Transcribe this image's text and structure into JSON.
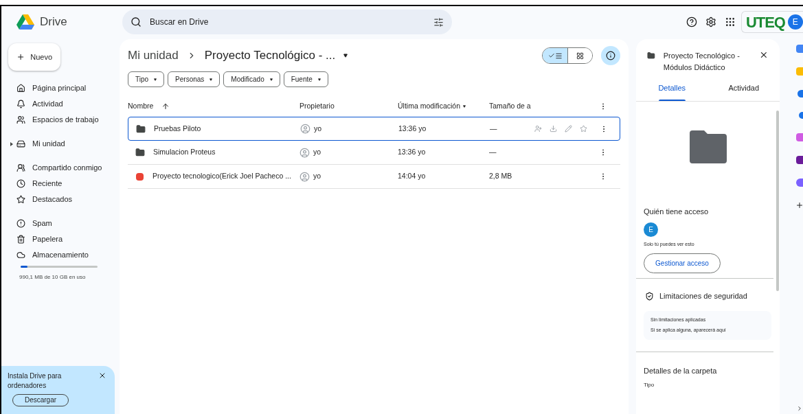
{
  "app": {
    "name": "Drive"
  },
  "search": {
    "placeholder": "Buscar en Drive"
  },
  "account": {
    "org": "UTEQ",
    "avatar": "E"
  },
  "new_button": "Nuevo",
  "nav": [
    [
      {
        "label": "Página principal"
      },
      {
        "label": "Actividad"
      },
      {
        "label": "Espacios de trabajo"
      }
    ],
    [
      {
        "label": "Mi unidad"
      }
    ],
    [
      {
        "label": "Compartido conmigo"
      },
      {
        "label": "Reciente"
      },
      {
        "label": "Destacados"
      }
    ],
    [
      {
        "label": "Spam"
      },
      {
        "label": "Papelera"
      },
      {
        "label": "Almacenamiento"
      }
    ]
  ],
  "storage": {
    "level": 0.09,
    "text": "990,1 MB de 10 GB en uso"
  },
  "promo": {
    "text": "Instala Drive para ordenadores",
    "button": "Descargar"
  },
  "breadcrumb": [
    "Mi unidad",
    "Proyecto Tecnológico - ..."
  ],
  "view_toggle": [
    {
      "selected": true
    },
    {
      "selected": false
    }
  ],
  "details_open": true,
  "filters": [
    "Tipo",
    "Personas",
    "Modificado",
    "Fuente"
  ],
  "table": {
    "columns": [
      "Nombre",
      "Propietario",
      "Última modificación",
      "Tamaño de a"
    ],
    "rows": [
      {
        "kind": "folder",
        "name": "Pruebas Piloto",
        "owner": "yo",
        "modified": "13:36 yo",
        "size": "—",
        "selected": true
      },
      {
        "kind": "folder",
        "name": "Simulacion Proteus",
        "owner": "yo",
        "modified": "13:36 yo",
        "size": "—",
        "selected": false
      },
      {
        "kind": "pdf",
        "name": "Proyecto tecnologico(Erick Joel Pacheco ...",
        "owner": "yo",
        "modified": "14:04 yo",
        "size": "2,8 MB",
        "selected": false
      }
    ]
  },
  "details": {
    "title": "Proyecto Tecnológico - Módulos Didáctico",
    "tabs": [
      {
        "label": "Detalles",
        "selected": true
      },
      {
        "label": "Actividad",
        "selected": false
      }
    ],
    "access_heading": "Quién tiene acceso",
    "access_avatar": "E",
    "access_note": "Solo tú puedes ver esto",
    "manage_button": "Gestionar acceso",
    "security_heading": "Limitaciones de seguridad",
    "security_lines": [
      "Sin limitaciones aplicadas",
      "Si se aplica alguna, aparecerá aquí"
    ],
    "folder_heading": "Detalles de la carpeta",
    "type_label": "Tipo"
  }
}
